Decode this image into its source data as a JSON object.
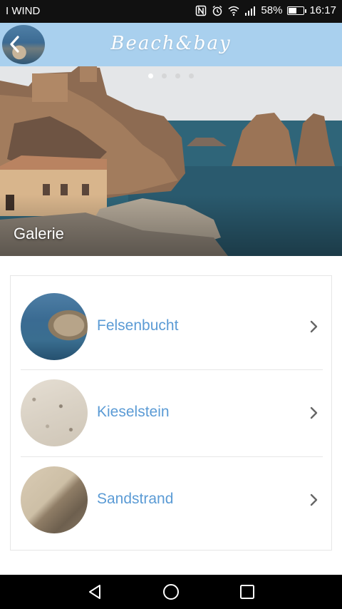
{
  "status_bar": {
    "carrier": "I WIND",
    "battery_percent": "58%",
    "battery_level": 0.58,
    "time": "16:17",
    "icons": [
      "nfc-icon",
      "alarm-icon",
      "wifi-icon",
      "signal-icon",
      "battery-icon"
    ]
  },
  "app_bar": {
    "logo_text": "Beach&bay",
    "back_icon": "chevron-left-icon"
  },
  "hero": {
    "caption": "Galerie",
    "slides_total": 4,
    "active_slide": 1
  },
  "list": {
    "items": [
      {
        "label": "Felsenbucht",
        "thumbnail": "rock-in-sea",
        "icon": "chevron-right-icon"
      },
      {
        "label": "Kieselstein",
        "thumbnail": "pebble-beach",
        "icon": "chevron-right-icon"
      },
      {
        "label": "Sandstrand",
        "thumbnail": "sand-beach",
        "icon": "chevron-right-icon"
      }
    ]
  },
  "nav_bar": {
    "buttons": [
      "back-triangle-icon",
      "home-circle-icon",
      "recents-square-icon"
    ]
  },
  "colors": {
    "app_bar": "#a9d0ee",
    "link_text": "#5b9bd5",
    "status_bar": "#111111",
    "nav_bar": "#000000"
  }
}
